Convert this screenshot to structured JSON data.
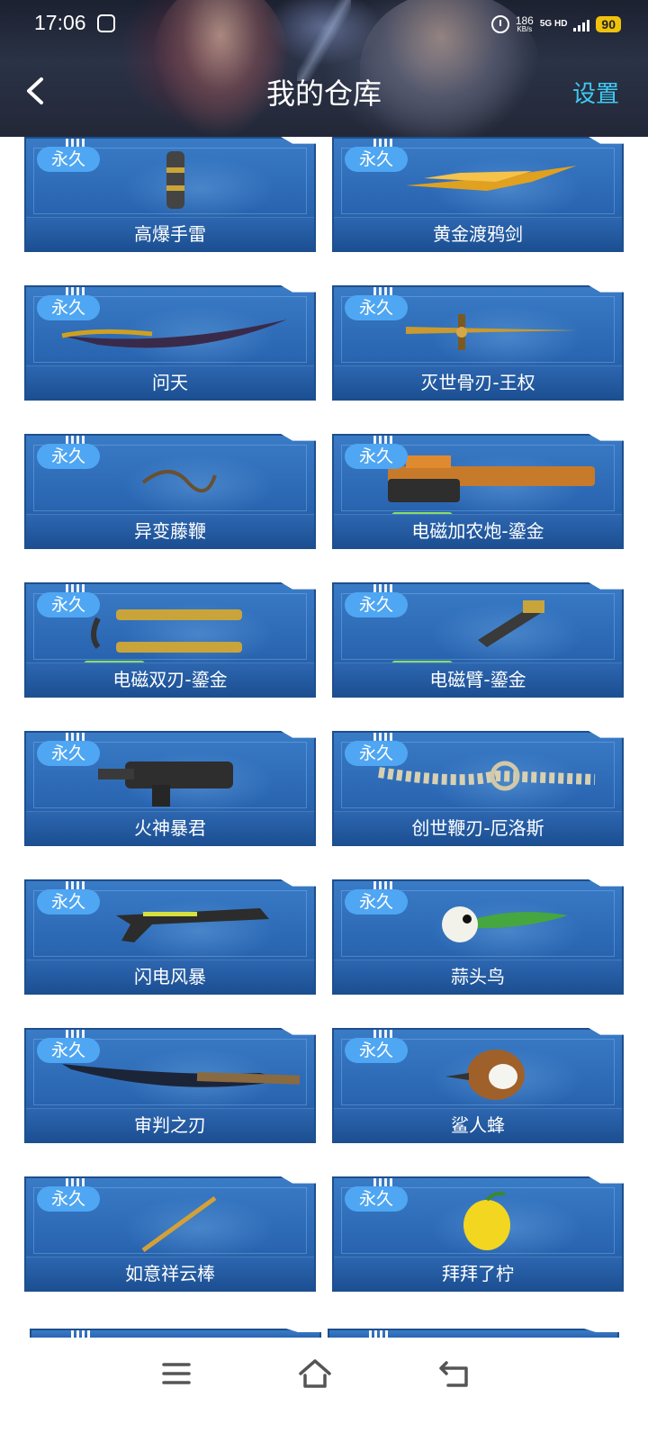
{
  "status_bar": {
    "time": "17:06",
    "net_speed_value": "186",
    "net_speed_unit": "KB/s",
    "network": "5G HD",
    "battery": "90"
  },
  "header": {
    "title": "我的仓库",
    "settings": "设置"
  },
  "items": [
    {
      "name": "高爆手雷",
      "tag": "永久",
      "set": ""
    },
    {
      "name": "黄金渡鸦剑",
      "tag": "永久",
      "set": ""
    },
    {
      "name": "问天",
      "tag": "永久",
      "set": ""
    },
    {
      "name": "灭世骨刃-王权",
      "tag": "永久",
      "set": ""
    },
    {
      "name": "异变藤鞭",
      "tag": "永久",
      "set": ""
    },
    {
      "name": "电磁加农炮-鎏金",
      "tag": "永久",
      "set": "套装"
    },
    {
      "name": "电磁双刃-鎏金",
      "tag": "永久",
      "set": "套装"
    },
    {
      "name": "电磁臂-鎏金",
      "tag": "永久",
      "set": "套装"
    },
    {
      "name": "火神暴君",
      "tag": "永久",
      "set": ""
    },
    {
      "name": "创世鞭刃-厄洛斯",
      "tag": "永久",
      "set": ""
    },
    {
      "name": "闪电风暴",
      "tag": "永久",
      "set": ""
    },
    {
      "name": "蒜头鸟",
      "tag": "永久",
      "set": ""
    },
    {
      "name": "审判之刃",
      "tag": "永久",
      "set": ""
    },
    {
      "name": "鲨人蜂",
      "tag": "永久",
      "set": ""
    },
    {
      "name": "如意祥云棒",
      "tag": "永久",
      "set": ""
    },
    {
      "name": "拜拜了柠",
      "tag": "永久",
      "set": ""
    }
  ],
  "icons": {
    "back": "chevron-left-icon",
    "menu": "menu-icon",
    "home": "home-icon",
    "return": "return-icon"
  },
  "colors": {
    "accent": "#3fc9f3",
    "card_blue": "#2a66b2",
    "tag_blue": "#4fa6f2",
    "set_green": "#46b036"
  }
}
